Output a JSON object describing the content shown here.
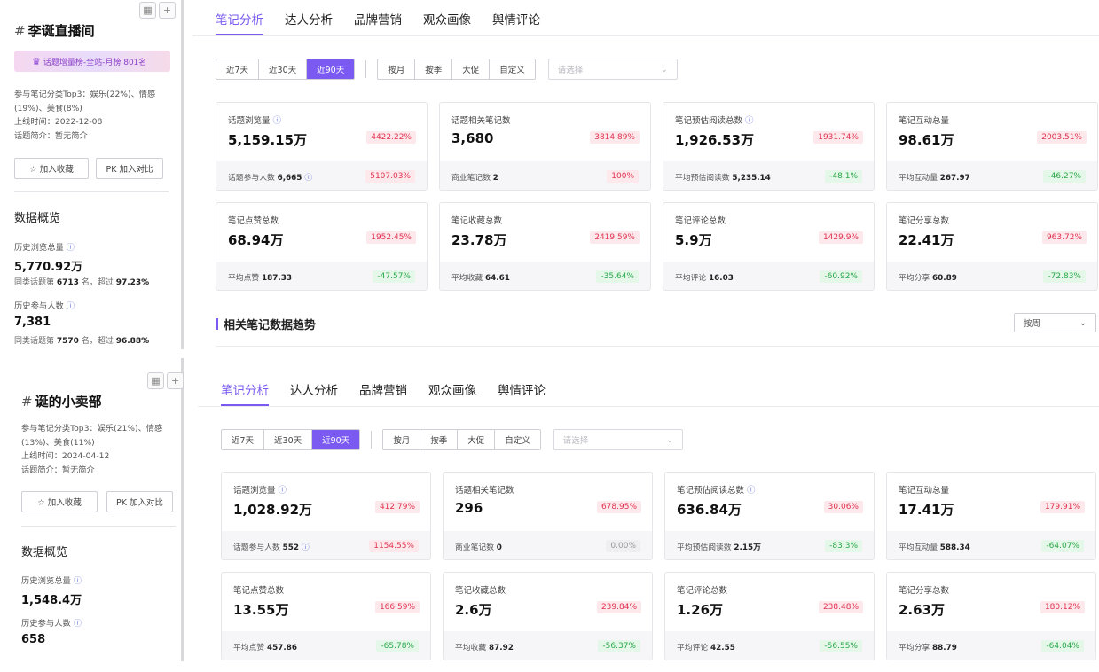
{
  "panels": [
    {
      "sidebar": {
        "hash": "#",
        "title": "李诞直播间",
        "rank_badge": "话题增量榜-全站-月榜 801名",
        "category_line1": "参与笔记分类Top3：娱乐(22%)、情感",
        "category_line2": "(19%)、美食(8%)",
        "online_time": "上线时间：2022-12-08",
        "intro": "话题简介：暂无简介",
        "fav_button": "☆ 加入收藏",
        "compare_button": "PK 加入对比",
        "overview_title": "数据概览",
        "views_label": "历史浏览总量",
        "views_value": "5,770.92万",
        "views_rank_pre": "同类话题第",
        "views_rank_num": "6713",
        "views_rank_mid": "名，超过",
        "views_rank_pct": "97.23%",
        "participants_label": "历史参与人数",
        "participants_value": "7,381",
        "part_rank_pre": "同类话题第",
        "part_rank_num": "7570",
        "part_rank_mid": "名，超过",
        "part_rank_pct": "96.88%"
      },
      "tabs": [
        "笔记分析",
        "达人分析",
        "品牌营销",
        "观众画像",
        "舆情评论"
      ],
      "filters": {
        "range": [
          "近7天",
          "近30天",
          "近90天"
        ],
        "period": [
          "按月",
          "按季",
          "大促",
          "自定义"
        ],
        "select_placeholder": "请选择"
      },
      "cards": [
        {
          "label": "话题浏览量",
          "q": true,
          "value": "5,159.15万",
          "pct": "4422.22%",
          "dir": "up",
          "sub_label": "话题参与人数",
          "sub_value": "6,665",
          "sub_q": true,
          "sub_pct": "5107.03%",
          "sub_dir": "up"
        },
        {
          "label": "话题相关笔记数",
          "q": false,
          "value": "3,680",
          "pct": "3814.89%",
          "dir": "up",
          "sub_label": "商业笔记数",
          "sub_value": "2",
          "sub_q": false,
          "sub_pct": "100%",
          "sub_dir": "up"
        },
        {
          "label": "笔记预估阅读总数",
          "q": true,
          "value": "1,926.53万",
          "pct": "1931.74%",
          "dir": "up",
          "sub_label": "平均预估阅读数",
          "sub_value": "5,235.14",
          "sub_q": false,
          "sub_pct": "-48.1%",
          "sub_dir": "down"
        },
        {
          "label": "笔记互动总量",
          "q": false,
          "value": "98.61万",
          "pct": "2003.51%",
          "dir": "up",
          "sub_label": "平均互动量",
          "sub_value": "267.97",
          "sub_q": false,
          "sub_pct": "-46.27%",
          "sub_dir": "down"
        },
        {
          "label": "笔记点赞总数",
          "q": false,
          "value": "68.94万",
          "pct": "1952.45%",
          "dir": "up",
          "sub_label": "平均点赞",
          "sub_value": "187.33",
          "sub_q": false,
          "sub_pct": "-47.57%",
          "sub_dir": "down"
        },
        {
          "label": "笔记收藏总数",
          "q": false,
          "value": "23.78万",
          "pct": "2419.59%",
          "dir": "up",
          "sub_label": "平均收藏",
          "sub_value": "64.61",
          "sub_q": false,
          "sub_pct": "-35.64%",
          "sub_dir": "down"
        },
        {
          "label": "笔记评论总数",
          "q": false,
          "value": "5.9万",
          "pct": "1429.9%",
          "dir": "up",
          "sub_label": "平均评论",
          "sub_value": "16.03",
          "sub_q": false,
          "sub_pct": "-60.92%",
          "sub_dir": "down"
        },
        {
          "label": "笔记分享总数",
          "q": false,
          "value": "22.41万",
          "pct": "963.72%",
          "dir": "up",
          "sub_label": "平均分享",
          "sub_value": "60.89",
          "sub_q": false,
          "sub_pct": "-72.83%",
          "sub_dir": "down"
        }
      ],
      "trend_title": "相关笔记数据趋势",
      "trend_select": "按周"
    },
    {
      "sidebar": {
        "hash": "#",
        "title": "诞的小卖部",
        "category_line1": "参与笔记分类Top3：娱乐(21%)、情感",
        "category_line2": "(13%)、美食(11%)",
        "online_time": "上线时间：2024-04-12",
        "intro": "话题简介：暂无简介",
        "fav_button": "☆ 加入收藏",
        "compare_button": "PK 加入对比",
        "overview_title": "数据概览",
        "views_label": "历史浏览总量",
        "views_value": "1,548.4万",
        "participants_label": "历史参与人数",
        "participants_value": "658"
      },
      "tabs": [
        "笔记分析",
        "达人分析",
        "品牌营销",
        "观众画像",
        "舆情评论"
      ],
      "filters": {
        "range": [
          "近7天",
          "近30天",
          "近90天"
        ],
        "period": [
          "按月",
          "按季",
          "大促",
          "自定义"
        ],
        "select_placeholder": "请选择"
      },
      "cards": [
        {
          "label": "话题浏览量",
          "q": true,
          "value": "1,028.92万",
          "pct": "412.79%",
          "dir": "up",
          "sub_label": "话题参与人数",
          "sub_value": "552",
          "sub_q": true,
          "sub_pct": "1154.55%",
          "sub_dir": "up"
        },
        {
          "label": "话题相关笔记数",
          "q": false,
          "value": "296",
          "pct": "678.95%",
          "dir": "up",
          "sub_label": "商业笔记数",
          "sub_value": "0",
          "sub_q": false,
          "sub_pct": "0.00%",
          "sub_dir": "neutral"
        },
        {
          "label": "笔记预估阅读总数",
          "q": true,
          "value": "636.84万",
          "pct": "30.06%",
          "dir": "up",
          "sub_label": "平均预估阅读数",
          "sub_value": "2.15万",
          "sub_q": false,
          "sub_pct": "-83.3%",
          "sub_dir": "down"
        },
        {
          "label": "笔记互动总量",
          "q": false,
          "value": "17.41万",
          "pct": "179.91%",
          "dir": "up",
          "sub_label": "平均互动量",
          "sub_value": "588.34",
          "sub_q": false,
          "sub_pct": "-64.07%",
          "sub_dir": "down"
        },
        {
          "label": "笔记点赞总数",
          "q": false,
          "value": "13.55万",
          "pct": "166.59%",
          "dir": "up",
          "sub_label": "平均点赞",
          "sub_value": "457.86",
          "sub_q": false,
          "sub_pct": "-65.78%",
          "sub_dir": "down"
        },
        {
          "label": "笔记收藏总数",
          "q": false,
          "value": "2.6万",
          "pct": "239.84%",
          "dir": "up",
          "sub_label": "平均收藏",
          "sub_value": "87.92",
          "sub_q": false,
          "sub_pct": "-56.37%",
          "sub_dir": "down"
        },
        {
          "label": "笔记评论总数",
          "q": false,
          "value": "1.26万",
          "pct": "238.48%",
          "dir": "up",
          "sub_label": "平均评论",
          "sub_value": "42.55",
          "sub_q": false,
          "sub_pct": "-56.55%",
          "sub_dir": "down"
        },
        {
          "label": "笔记分享总数",
          "q": false,
          "value": "2.63万",
          "pct": "180.12%",
          "dir": "up",
          "sub_label": "平均分享",
          "sub_value": "88.79",
          "sub_q": false,
          "sub_pct": "-64.04%",
          "sub_dir": "down"
        }
      ]
    }
  ],
  "colors": {
    "accent": "#7a5af0",
    "up": "#e0324f",
    "down": "#2aa84a"
  }
}
